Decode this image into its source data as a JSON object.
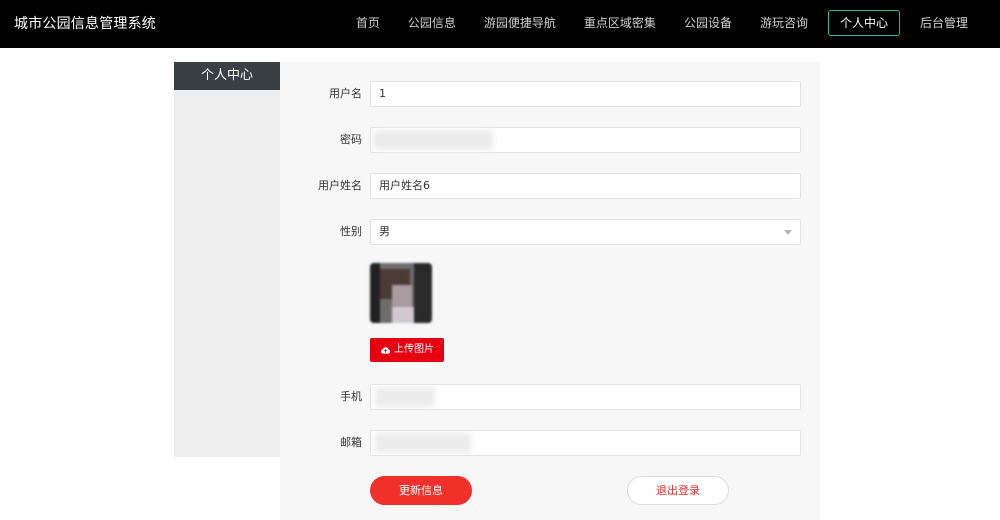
{
  "header": {
    "brand": "城市公园信息管理系统",
    "nav": [
      {
        "label": "首页",
        "name": "nav-home"
      },
      {
        "label": "公园信息",
        "name": "nav-park-info"
      },
      {
        "label": "游园便捷导航",
        "name": "nav-navigation"
      },
      {
        "label": "重点区域密集",
        "name": "nav-key-areas"
      },
      {
        "label": "公园设备",
        "name": "nav-equipment"
      },
      {
        "label": "游玩咨询",
        "name": "nav-consult"
      },
      {
        "label": "个人中心",
        "name": "nav-personal-center",
        "active": true
      },
      {
        "label": "后台管理",
        "name": "nav-admin"
      }
    ]
  },
  "sidebar": {
    "title": "个人中心"
  },
  "form": {
    "username_label": "用户名",
    "username_value": "1",
    "password_label": "密码",
    "realname_label": "用户姓名",
    "realname_value": "用户姓名6",
    "gender_label": "性别",
    "gender_value": "男",
    "upload_label": "上传图片",
    "phone_label": "手机",
    "email_label": "邮箱",
    "update_button": "更新信息",
    "logout_button": "退出登录"
  },
  "colors": {
    "topbar": "#000000",
    "active_nav_border": "#2fb39a",
    "upload_red": "#e50012",
    "update_red": "#f0302a"
  }
}
